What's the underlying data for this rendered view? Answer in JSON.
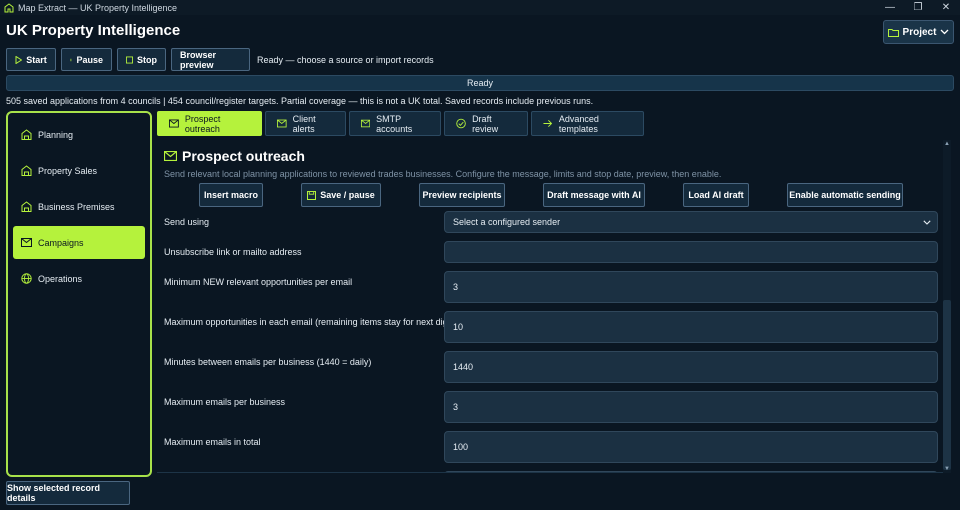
{
  "window": {
    "title": "Map Extract — UK Property Intelligence",
    "minimize": "—",
    "restore": "❐",
    "close": "✕"
  },
  "header": {
    "title": "UK Property Intelligence",
    "project_label": "Project"
  },
  "toolbar": {
    "start": "Start",
    "pause": "Pause",
    "stop": "Stop",
    "browser_preview": "Browser preview",
    "status": "Ready — choose a source or import records"
  },
  "progress": {
    "label": "Ready"
  },
  "summary": "505 saved applications from 4 councils | 454 council/register targets. Partial coverage — this is not a UK total. Saved records include previous runs.",
  "sidebar": {
    "items": [
      {
        "label": "Planning",
        "icon": "building-icon"
      },
      {
        "label": "Property Sales",
        "icon": "building-icon"
      },
      {
        "label": "Business Premises",
        "icon": "building-icon"
      },
      {
        "label": "Campaigns",
        "icon": "mail-icon"
      },
      {
        "label": "Operations",
        "icon": "globe-icon"
      }
    ],
    "active_index": 3
  },
  "tabs": [
    {
      "label": "Prospect outreach",
      "icon": "mail-icon"
    },
    {
      "label": "Client alerts",
      "icon": "mail-icon"
    },
    {
      "label": "SMTP accounts",
      "icon": "mail-icon"
    },
    {
      "label": "Draft review",
      "icon": "check-circle-icon"
    },
    {
      "label": "Advanced templates",
      "icon": "arrow-right-icon"
    }
  ],
  "panel": {
    "title": "Prospect outreach",
    "description": "Send relevant local planning applications to reviewed trades businesses. Configure the message, limits and stop date, preview, then enable.",
    "actions": {
      "insert_macro": "Insert macro",
      "save_pause": "Save / pause",
      "preview_recipients": "Preview recipients",
      "draft_ai": "Draft message with AI",
      "load_ai_draft": "Load AI draft",
      "enable_sending": "Enable automatic sending"
    },
    "fields": {
      "send_using": {
        "label": "Send using",
        "value": "Select a configured sender"
      },
      "unsubscribe": {
        "label": "Unsubscribe link or mailto address",
        "value": ""
      },
      "min_new": {
        "label": "Minimum NEW relevant opportunities per email",
        "value": "3"
      },
      "max_opps": {
        "label": "Maximum opportunities in each email (remaining items stay for next digest)",
        "value": "10"
      },
      "minutes_between": {
        "label": "Minutes between emails per business (1440 = daily)",
        "value": "1440"
      },
      "max_per_business": {
        "label": "Maximum emails per business",
        "value": "3"
      },
      "max_total": {
        "label": "Maximum emails in total",
        "value": "100"
      }
    }
  },
  "footer": {
    "show_details": "Show selected record details"
  },
  "colors": {
    "accent": "#b5f23c",
    "background": "#0a1622",
    "button": "#142a3c"
  }
}
